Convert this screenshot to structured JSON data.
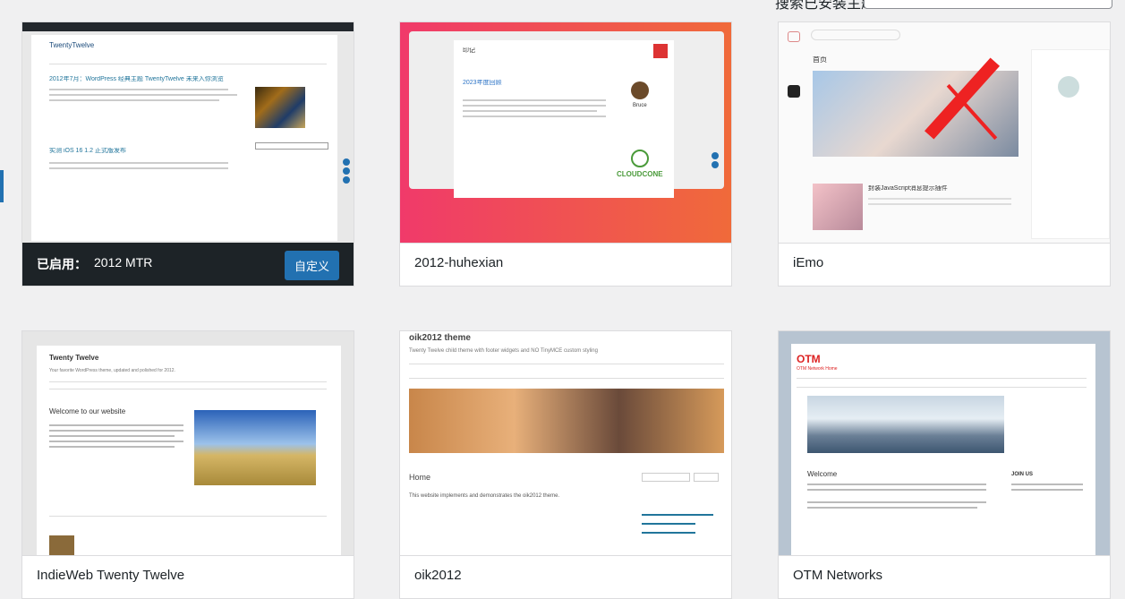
{
  "header": {
    "search_label": "搜索已安装主题",
    "search_placeholder": ""
  },
  "themes": [
    {
      "name": "2012 MTR",
      "active": true,
      "active_label": "已启用：",
      "customize_label": "自定义",
      "preview": {
        "site_title": "TwentyTwelve",
        "post_title": "2012年7月：WordPress 经典主题 TwentyTwelve 未来入你浏览",
        "post2_title": "实测 iOS 16 1.2 正式版发布"
      }
    },
    {
      "name": "2012-huhexian",
      "preview": {
        "site_title": "印记",
        "post_title": "2023年度回顾",
        "author": "Bruce",
        "logo": "CLOUDCONE"
      }
    },
    {
      "name": "iEmo",
      "preview": {
        "home_label": "首页",
        "post_title": "封装JavaScript消息提示插件"
      }
    },
    {
      "name": "IndieWeb Twenty Twelve",
      "preview": {
        "site_title": "Twenty Twelve",
        "tagline": "Your favorite WordPress theme, updated and polished for 2012.",
        "welcome": "Welcome to our website"
      }
    },
    {
      "name": "oik2012",
      "preview": {
        "site_title": "oik2012 theme",
        "tagline": "Twenty Twelve child theme with footer widgets and NO TinyMCE custom styling",
        "page_title": "Home",
        "body_line": "This website implements and demonstrates the oik2012 theme."
      }
    },
    {
      "name": "OTM Networks",
      "preview": {
        "logo": "OTM",
        "subtitle": "OTM Network Home",
        "welcome": "Welcome",
        "join": "JOIN US"
      }
    }
  ]
}
